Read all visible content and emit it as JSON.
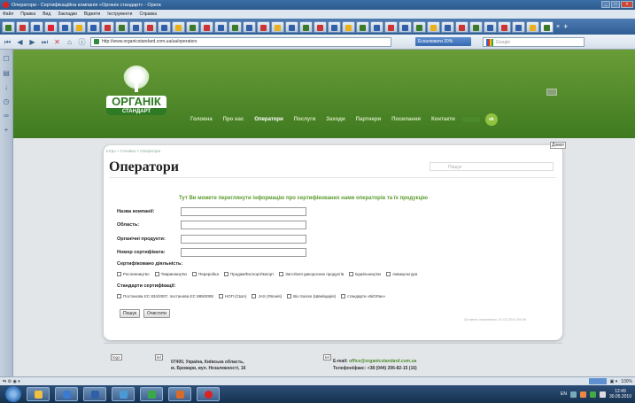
{
  "browser": {
    "title": "Оператори - Сертифікаційна компанія «Органік стандарт» - Opera",
    "menu": [
      "Файл",
      "Правка",
      "Вид",
      "Закладки",
      "Віджети",
      "Інструменти",
      "Справка"
    ],
    "url": "http://www.organicstandard.com.ua/ua/operators",
    "zoom_label": "Ескалювати 20%",
    "search_placeholder": "Google",
    "status_zoom": "100%"
  },
  "site": {
    "logo_line1": "ОРГАНІК",
    "logo_line2": "СТАНДАРТ",
    "nav": [
      {
        "label": "Головна"
      },
      {
        "label": "Про нас"
      },
      {
        "label": "Оператори"
      },
      {
        "label": "Послуги"
      },
      {
        "label": "Заходи"
      },
      {
        "label": "Партнери"
      },
      {
        "label": "Посилання"
      },
      {
        "label": "Контакти"
      }
    ],
    "nav_go": "ok"
  },
  "page": {
    "breadcrumb": "Інтро > Головна > Оператори",
    "print_label": "Домог",
    "title": "Оператори",
    "search_placeholder": "Пошук",
    "intro": "Тут Ви можете переглянути інформацію про сертифікованих нами операторів та їх продукцію",
    "fields": [
      {
        "label": "Назва компанії:"
      },
      {
        "label": "Область:"
      },
      {
        "label": "Органічні продукти:"
      },
      {
        "label": "Номер сертифіката:"
      }
    ],
    "activities_label": "Сертифіковано діяльність:",
    "activities": [
      "Рослинництво",
      "Тваринництво",
      "Переробка",
      "Продаж/Експорт/Імпорт",
      "Заготівля дикоросних продуктів",
      "Бджільництво",
      "Аквакультура"
    ],
    "standards_label": "Стандарти сертифікації:",
    "standards": [
      "Постанова ЄС 834/2007, постанова ЄС 889/2008",
      "НОП (США)",
      "JAS (Японія)",
      "Bio Suisse (Швейцарія)",
      "стандарти «БіОЛан»"
    ],
    "search_button": "Пошук",
    "clear_button": "Очистити",
    "last_update": "Останнє оновлення: 01.03.2010 09:09"
  },
  "footer": {
    "logo_img": "logo",
    "addr_icon": "tel",
    "address_line1": "07400, Україна, Київська область,",
    "address_line2": "м. Бровари, вул. Незалежності, 16",
    "email_icon": "tel",
    "email_label": "E-mail:",
    "email": "office@organicstandard.com.ua",
    "phone": "Телефон/факс: +38 (044) 206-82-15 (16)"
  },
  "taskbar": {
    "lang": "EN",
    "time": "12:49",
    "date": "30.05.2010"
  }
}
